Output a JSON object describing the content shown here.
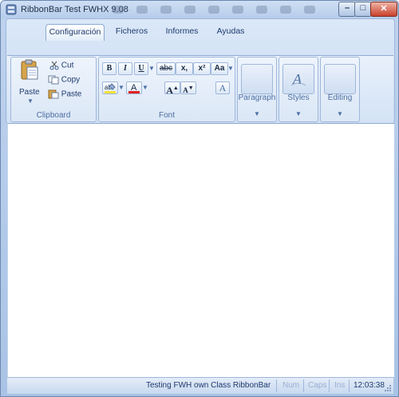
{
  "window": {
    "title": "RibbonBar Test FWHX 9.08",
    "minimize_glyph": "–",
    "maximize_glyph": "□",
    "close_glyph": "✕"
  },
  "tabs": [
    {
      "label": "Configuración",
      "active": true
    },
    {
      "label": "Ficheros",
      "active": false
    },
    {
      "label": "Informes",
      "active": false
    },
    {
      "label": "Ayudas",
      "active": false
    }
  ],
  "groups": {
    "clipboard": {
      "label": "Clipboard",
      "paste_big_label": "Paste",
      "cut_label": "Cut",
      "copy_label": "Copy",
      "paste_small_label": "Paste"
    },
    "font": {
      "label": "Font",
      "bold": "B",
      "italic": "I",
      "underline": "U",
      "strike": "abc",
      "subscript": "x,",
      "superscript": "x²",
      "change_case": "Aa",
      "grow_font": "A",
      "shrink_font": "A"
    },
    "paragraph": {
      "label": "Paragraph"
    },
    "styles": {
      "label": "Styles"
    },
    "editing": {
      "label": "Editing"
    }
  },
  "statusbar": {
    "message": "Testing FWH own Class RibbonBar",
    "num": "Num",
    "caps": "Caps",
    "ins": "Ins",
    "time": "12:03:38"
  },
  "colors": {
    "accent": "#4b6ea3",
    "highlight_marker": "#f2e33b",
    "font_color_bar": "#e02020"
  }
}
